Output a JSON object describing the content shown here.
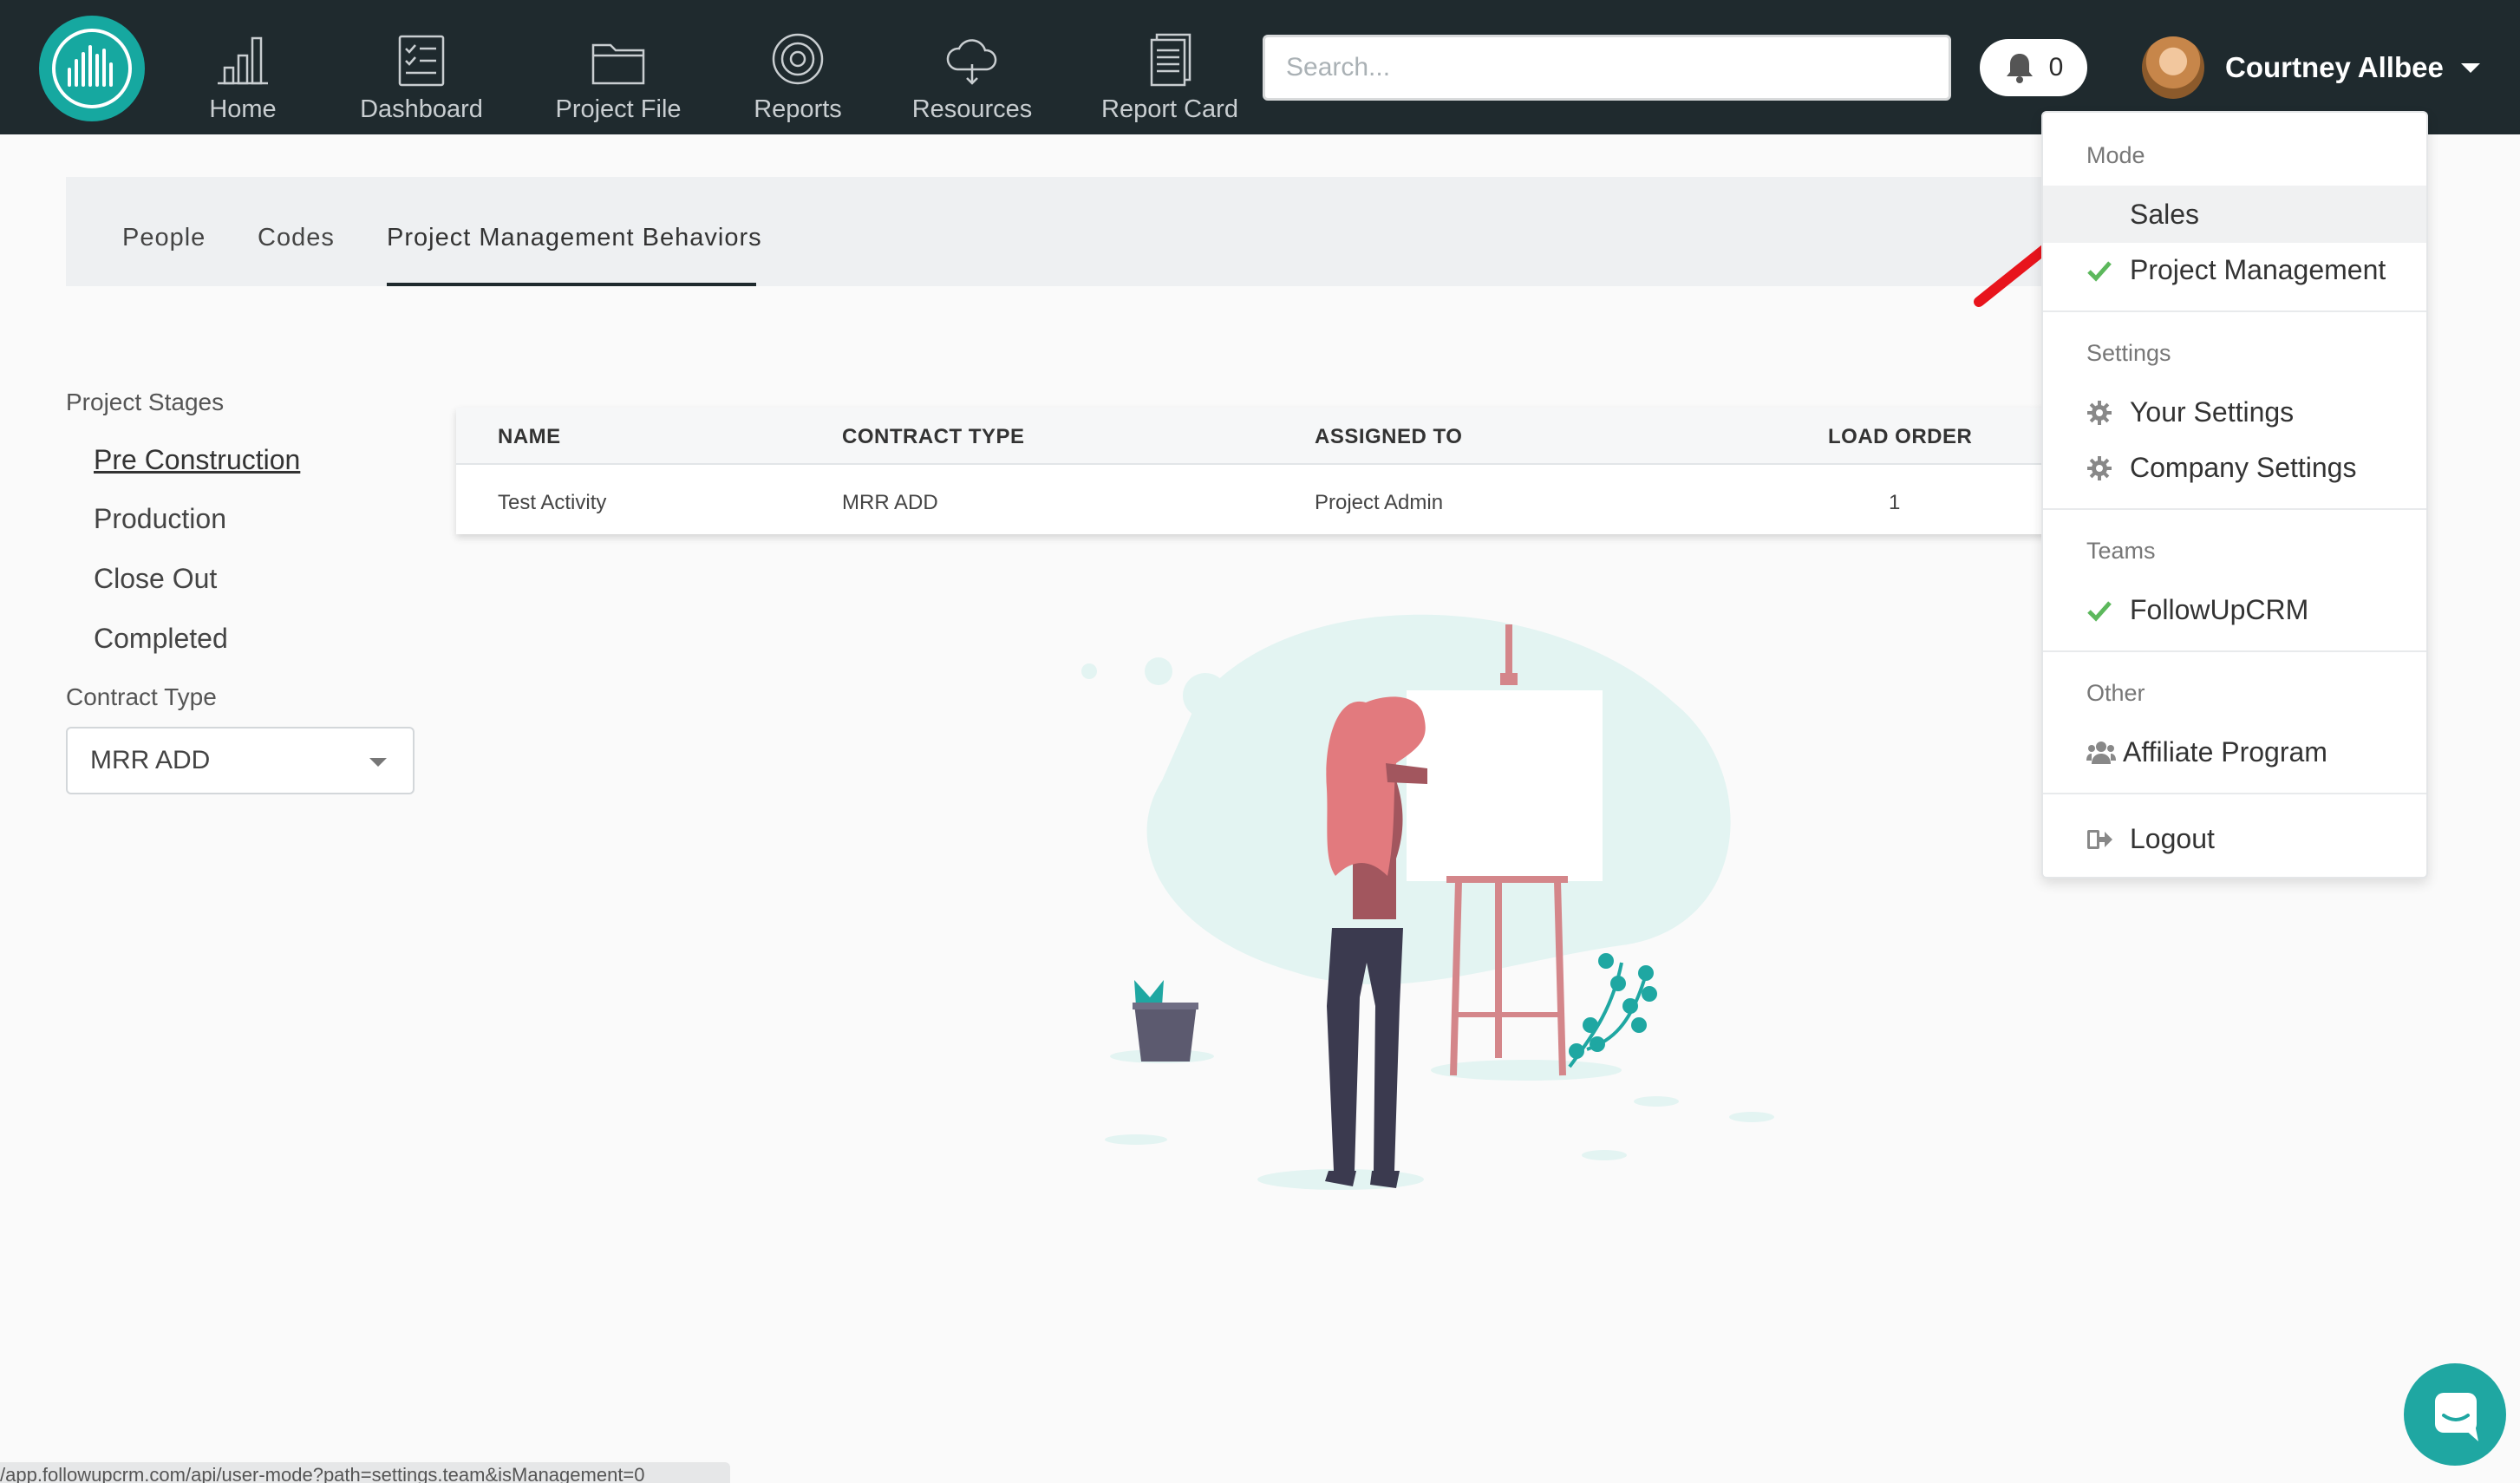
{
  "nav": {
    "items": [
      {
        "label": "Home",
        "icon": "bar-chart-icon"
      },
      {
        "label": "Dashboard",
        "icon": "checklist-icon"
      },
      {
        "label": "Project File",
        "icon": "folder-icon"
      },
      {
        "label": "Reports",
        "icon": "target-icon"
      },
      {
        "label": "Resources",
        "icon": "cloud-icon"
      },
      {
        "label": "Report Card",
        "icon": "document-icon"
      }
    ],
    "search_placeholder": "Search...",
    "notification_count": "0",
    "user_name": "Courtney Allbee"
  },
  "tabs": [
    "People",
    "Codes",
    "Project Management Behaviors"
  ],
  "active_tab": "Project Management Behaviors",
  "sidebar": {
    "project_stages_heading": "Project Stages",
    "stages": [
      "Pre Construction",
      "Production",
      "Close Out",
      "Completed"
    ],
    "active_stage": "Pre Construction",
    "contract_type_heading": "Contract Type",
    "contract_type_value": "MRR ADD"
  },
  "table": {
    "columns": [
      "NAME",
      "CONTRACT TYPE",
      "ASSIGNED TO",
      "LOAD ORDER"
    ],
    "rows": [
      {
        "name": "Test Activity",
        "contract_type": "MRR ADD",
        "assigned_to": "Project Admin",
        "load_order": "1"
      }
    ]
  },
  "dropdown": {
    "mode_heading": "Mode",
    "mode_items": [
      {
        "label": "Sales",
        "checked": false
      },
      {
        "label": "Project Management",
        "checked": true
      }
    ],
    "settings_heading": "Settings",
    "settings_items": [
      "Your Settings",
      "Company Settings"
    ],
    "teams_heading": "Teams",
    "team_items": [
      {
        "label": "FollowUpCRM",
        "checked": true
      }
    ],
    "other_heading": "Other",
    "other_items": [
      "Affiliate Program"
    ],
    "logout_label": "Logout"
  },
  "status_url": "/app.followupcrm.com/api/user-mode?path=settings.team&isManagement=0",
  "colors": {
    "topbar": "#1f2a2e",
    "brand_teal": "#16a8a0",
    "check_green": "#5cb85c",
    "arrow_red": "#e8141c"
  }
}
